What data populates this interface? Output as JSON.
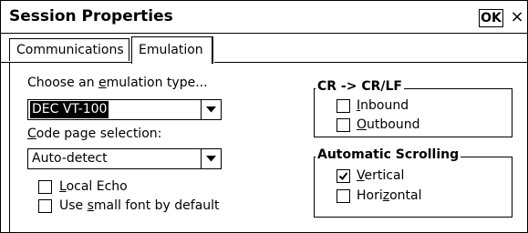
{
  "window": {
    "title": "Session Properties",
    "ok_label": "OK",
    "close_glyph": "×"
  },
  "tabs": [
    {
      "label": "Communications",
      "selected": false
    },
    {
      "label": "Emulation",
      "selected": true
    }
  ],
  "emulation": {
    "type_label_pre": "Choose an ",
    "type_label_u": "e",
    "type_label_post": "mulation type...",
    "type_value": "DEC VT-100",
    "codepage_label_u": "C",
    "codepage_label_post": "ode page selection:",
    "codepage_value": "Auto-detect",
    "local_echo": {
      "label_u": "L",
      "label_post": "ocal Echo",
      "checked": false
    },
    "small_font": {
      "label_pre": "Use ",
      "label_u": "s",
      "label_post": "mall font by default",
      "checked": false
    }
  },
  "crlf": {
    "title": "CR -> CR/LF",
    "inbound": {
      "label_u": "I",
      "label_post": "nbound",
      "checked": false
    },
    "outbound": {
      "label_u": "O",
      "label_post": "utbound",
      "checked": false
    }
  },
  "scrolling": {
    "title": "Automatic Scrolling",
    "vertical": {
      "label_u": "V",
      "label_post": "ertical",
      "checked": true
    },
    "horizontal": {
      "label_pre": "Hori",
      "label_u": "z",
      "label_post": "ontal",
      "checked": false
    }
  },
  "icons": {
    "combo_arrow": "chevron-down-icon",
    "check": "checkmark-icon"
  }
}
